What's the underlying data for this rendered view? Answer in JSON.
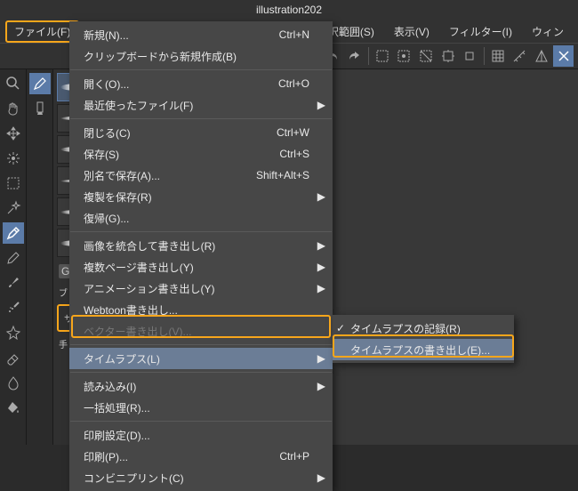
{
  "title": "illustration202",
  "menubar": {
    "file": "ファイル(F)",
    "select": "選択範囲(S)",
    "view": "表示(V)",
    "filter": "フィルター(I)",
    "window": "ウィン"
  },
  "menu": {
    "new": "新規(N)...",
    "new_sc": "Ctrl+N",
    "clipboard_new": "クリップボードから新規作成(B)",
    "open": "開く(O)...",
    "open_sc": "Ctrl+O",
    "recent": "最近使ったファイル(F)",
    "close": "閉じる(C)",
    "close_sc": "Ctrl+W",
    "save": "保存(S)",
    "save_sc": "Ctrl+S",
    "save_as": "別名で保存(A)...",
    "save_as_sc": "Shift+Alt+S",
    "save_dup": "複製を保存(R)",
    "revert": "復帰(G)...",
    "merge_export": "画像を統合して書き出し(R)",
    "multi_export": "複数ページ書き出し(Y)",
    "anim_export": "アニメーション書き出し(Y)",
    "webtoon": "Webtoon書き出し...",
    "vector_export": "ベクター書き出し(V)...",
    "timelapse": "タイムラプス(L)",
    "import": "読み込み(I)",
    "batch": "一括処理(R)...",
    "print_pref": "印刷設定(D)...",
    "print": "印刷(P)...",
    "print_sc": "Ctrl+P",
    "conv_print": "コンビニプリント(C)"
  },
  "submenu": {
    "record": "タイムラプスの記録(R)",
    "export": "タイムラプスの書き出し(E)..."
  },
  "panel": {
    "gpen": "Gペン",
    "brush_short": "ブ",
    "sub_short": "サ",
    "hand": "手"
  }
}
